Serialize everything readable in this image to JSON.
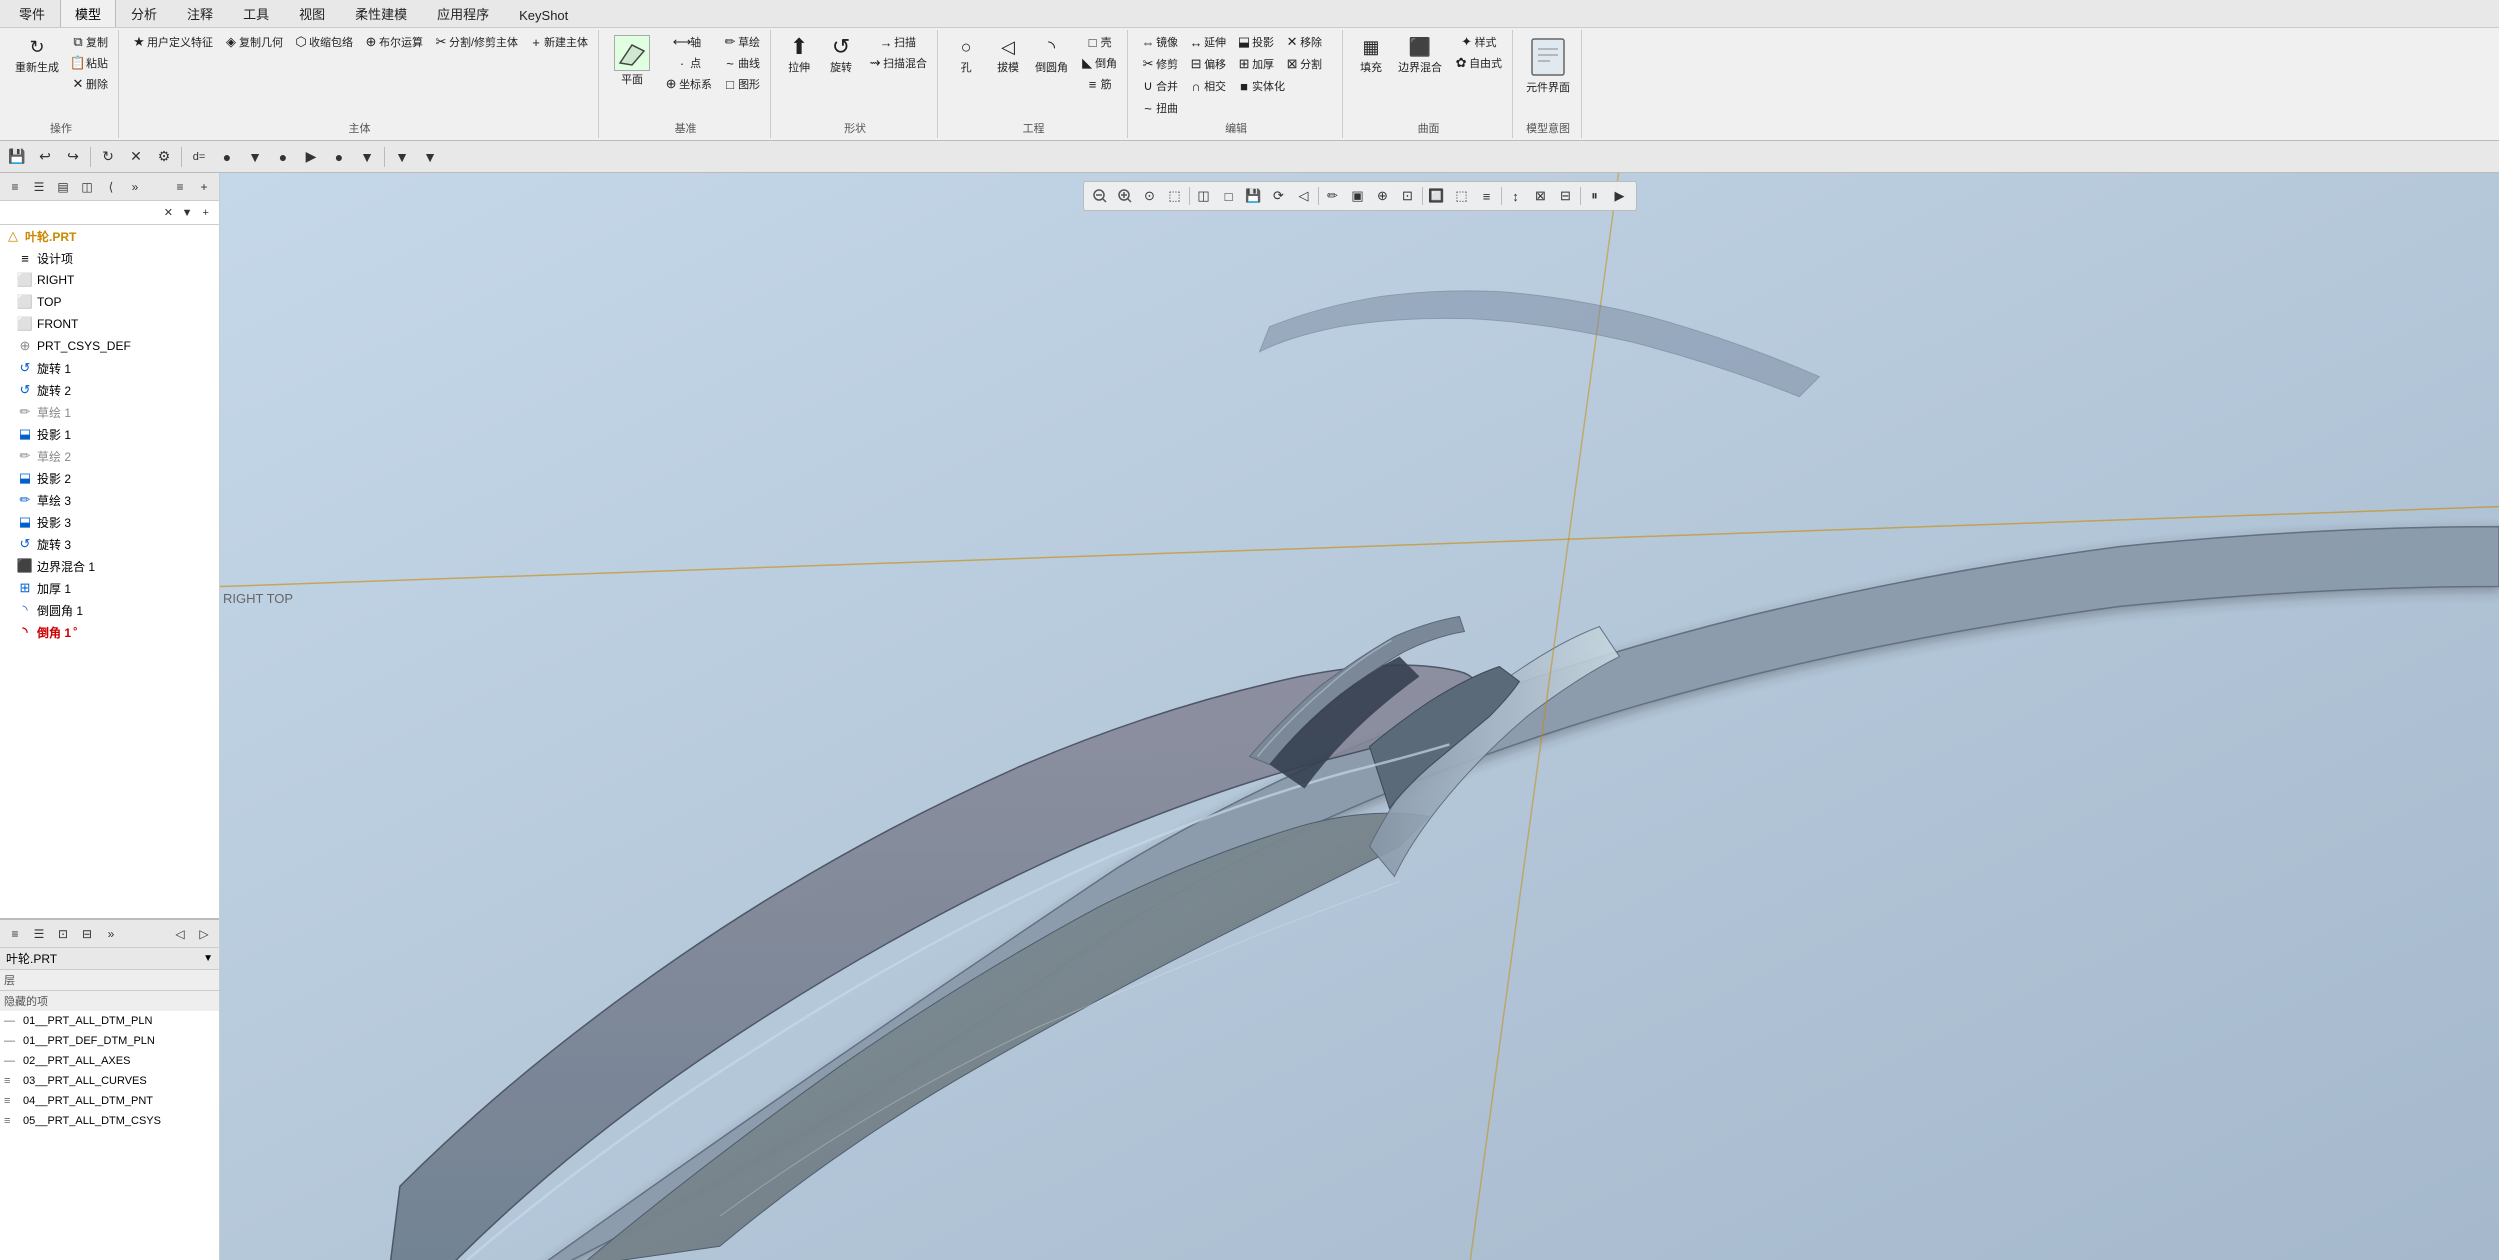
{
  "ribbon": {
    "tabs": [
      "零件",
      "模型",
      "分析",
      "注释",
      "工具",
      "视图",
      "柔性建模",
      "应用程序",
      "KeyShot"
    ],
    "active_tab": "模型",
    "groups": [
      {
        "label": "操作",
        "buttons": [
          {
            "label": "重新生成",
            "icon": "↻"
          },
          {
            "label": "复制",
            "icon": "⧉"
          },
          {
            "label": "粘贴",
            "icon": "📋"
          },
          {
            "label": "删除",
            "icon": "✕"
          }
        ]
      },
      {
        "label": "主体",
        "buttons": [
          {
            "label": "用户定义特征",
            "icon": "★"
          },
          {
            "label": "复制几何",
            "icon": "◈"
          },
          {
            "label": "收缩包络",
            "icon": "⬡"
          },
          {
            "label": "布尔运算",
            "icon": "⊕"
          },
          {
            "label": "分割/修剪主体",
            "icon": "✂"
          },
          {
            "label": "新建主体",
            "icon": "+"
          }
        ]
      },
      {
        "label": "基准",
        "buttons": [
          {
            "label": "平面",
            "icon": "▱"
          },
          {
            "label": "轴",
            "icon": "⟷"
          },
          {
            "label": "点",
            "icon": "·"
          },
          {
            "label": "坐标系",
            "icon": "⊕"
          },
          {
            "label": "草绘",
            "icon": "✏"
          },
          {
            "label": "曲线",
            "icon": "~"
          },
          {
            "label": "图形",
            "icon": "□"
          }
        ]
      },
      {
        "label": "形状",
        "buttons": [
          {
            "label": "拉伸",
            "icon": "⬆"
          },
          {
            "label": "旋转",
            "icon": "↺"
          },
          {
            "label": "扫描",
            "icon": "→"
          },
          {
            "label": "扫描混合",
            "icon": "⇝"
          }
        ]
      },
      {
        "label": "工程",
        "buttons": [
          {
            "label": "孔",
            "icon": "○"
          },
          {
            "label": "拔模",
            "icon": "◁"
          },
          {
            "label": "倒圆角",
            "icon": "◝"
          },
          {
            "label": "壳",
            "icon": "□"
          },
          {
            "label": "倒角",
            "icon": "◣"
          },
          {
            "label": "筋",
            "icon": "≡"
          }
        ]
      },
      {
        "label": "编辑",
        "buttons": [
          {
            "label": "镜像",
            "icon": "⇔"
          },
          {
            "label": "延伸",
            "icon": "↔"
          },
          {
            "label": "投影",
            "icon": "⬓"
          },
          {
            "label": "移除",
            "icon": "✕"
          },
          {
            "label": "修剪",
            "icon": "✂"
          },
          {
            "label": "偏移",
            "icon": "⊟"
          },
          {
            "label": "加厚",
            "icon": "⊞"
          },
          {
            "label": "分割",
            "icon": "⊠"
          },
          {
            "label": "合并",
            "icon": "∪"
          },
          {
            "label": "相交",
            "icon": "∩"
          },
          {
            "label": "实体化",
            "icon": "■"
          },
          {
            "label": "扭曲",
            "icon": "~"
          }
        ]
      },
      {
        "label": "曲面",
        "buttons": [
          {
            "label": "填充",
            "icon": "▦"
          },
          {
            "label": "边界混合",
            "icon": "⬛"
          },
          {
            "label": "样式",
            "icon": "✦"
          },
          {
            "label": "自由式",
            "icon": "✿"
          }
        ]
      },
      {
        "label": "模型意图",
        "buttons": [
          {
            "label": "元件界面",
            "icon": "⬚"
          }
        ]
      }
    ]
  },
  "main_toolbar": {
    "buttons": [
      "💾",
      "↩",
      "↪",
      "⊡",
      "✕",
      "⚙",
      "d=",
      "●",
      "▼",
      "●",
      "▶",
      "●",
      "▼",
      "▼"
    ]
  },
  "left_panel": {
    "top": {
      "toolbar_buttons": [
        "≡",
        "☰",
        "▤",
        "◫",
        "⟨",
        "»",
        "≡",
        "≡"
      ],
      "search_placeholder": "",
      "tree_items": [
        {
          "icon": "△",
          "label": "叶轮.PRT",
          "level": 0,
          "type": "root"
        },
        {
          "icon": "≡",
          "label": "设计项",
          "level": 1,
          "type": "feature"
        },
        {
          "icon": "⬜",
          "label": "RIGHT",
          "level": 1,
          "type": "datum"
        },
        {
          "icon": "⬜",
          "label": "TOP",
          "level": 1,
          "type": "datum"
        },
        {
          "icon": "⬜",
          "label": "FRONT",
          "level": 1,
          "type": "datum"
        },
        {
          "icon": "⊕",
          "label": "PRT_CSYS_DEF",
          "level": 1,
          "type": "csys"
        },
        {
          "icon": "↺",
          "label": "旋转 1",
          "level": 1,
          "type": "feature"
        },
        {
          "icon": "↺",
          "label": "旋转 2",
          "level": 1,
          "type": "feature"
        },
        {
          "icon": "✏",
          "label": "草绘 1",
          "level": 1,
          "type": "sketch"
        },
        {
          "icon": "⬓",
          "label": "投影 1",
          "level": 1,
          "type": "project"
        },
        {
          "icon": "✏",
          "label": "草绘 2",
          "level": 1,
          "type": "sketch"
        },
        {
          "icon": "⬓",
          "label": "投影 2",
          "level": 1,
          "type": "project"
        },
        {
          "icon": "✏",
          "label": "草绘 3",
          "level": 1,
          "type": "sketch"
        },
        {
          "icon": "⬓",
          "label": "投影 3",
          "level": 1,
          "type": "project"
        },
        {
          "icon": "↺",
          "label": "旋转 3",
          "level": 1,
          "type": "feature"
        },
        {
          "icon": "⬛",
          "label": "边界混合 1",
          "level": 1,
          "type": "surface"
        },
        {
          "icon": "⊞",
          "label": "加厚 1",
          "level": 1,
          "type": "thicken"
        },
        {
          "icon": "◝",
          "label": "倒圆角 1",
          "level": 1,
          "type": "round"
        },
        {
          "icon": "◝",
          "label": "倒角 1",
          "level": 1,
          "type": "chamfer",
          "active": true
        }
      ]
    },
    "bottom": {
      "title": "叶轮.PRT",
      "title_arrow": "▼",
      "section_label": "层",
      "layers_header": "隐藏的项",
      "layers": [
        {
          "icon": "—",
          "label": "01__PRT_ALL_DTM_PLN"
        },
        {
          "icon": "—",
          "label": "01__PRT_DEF_DTM_PLN"
        },
        {
          "icon": "—",
          "label": "02__PRT_ALL_AXES"
        },
        {
          "icon": "≡",
          "label": "03__PRT_ALL_CURVES"
        },
        {
          "icon": "≡",
          "label": "04__PRT_ALL_DTM_PNT"
        },
        {
          "icon": "≡",
          "label": "05__PRT_ALL_DTM_CSYS"
        }
      ]
    }
  },
  "viewport": {
    "toolbar_buttons": [
      {
        "icon": "🔍",
        "title": "缩小"
      },
      {
        "icon": "🔍",
        "title": "放大"
      },
      {
        "icon": "⊙",
        "title": "缩放到适合"
      },
      {
        "icon": "⬚",
        "title": "框选缩放"
      },
      {
        "icon": "◫",
        "title": "切换方向"
      },
      {
        "icon": "□",
        "title": "视图框"
      },
      {
        "icon": "⊡",
        "title": "保存视图"
      },
      {
        "icon": "⟳",
        "title": "重置视图"
      },
      {
        "icon": "◁",
        "title": "上一个"
      },
      {
        "icon": "▷",
        "title": "下一个"
      },
      {
        "icon": "✏",
        "title": "草绘"
      },
      {
        "icon": "▣",
        "title": "捕捉"
      },
      {
        "icon": "⊕",
        "title": "坐标系"
      },
      {
        "icon": "⊡",
        "title": "选项"
      },
      {
        "icon": "🔲",
        "title": "着色"
      },
      {
        "icon": "⬚",
        "title": "边框"
      },
      {
        "icon": "≡",
        "title": "线框"
      },
      {
        "icon": "↕",
        "title": "重定向"
      },
      {
        "icon": "⊠",
        "title": "视图管理"
      },
      {
        "icon": "⊟",
        "title": "外观"
      },
      {
        "icon": "⏸",
        "title": "暂停"
      },
      {
        "icon": "▶",
        "title": "播放"
      }
    ]
  },
  "right_top_label": "RIGHT TOP",
  "colors": {
    "accent_green": "#00aa00",
    "toolbar_bg": "#e8e8e8",
    "ribbon_bg": "#f0f0f0",
    "panel_bg": "#f5f5f5",
    "viewport_bg_start": "#c8d8e8",
    "viewport_bg_end": "#a8bccc",
    "active_op_color": "#cc0000",
    "datum_line_color": "#cc8800"
  }
}
